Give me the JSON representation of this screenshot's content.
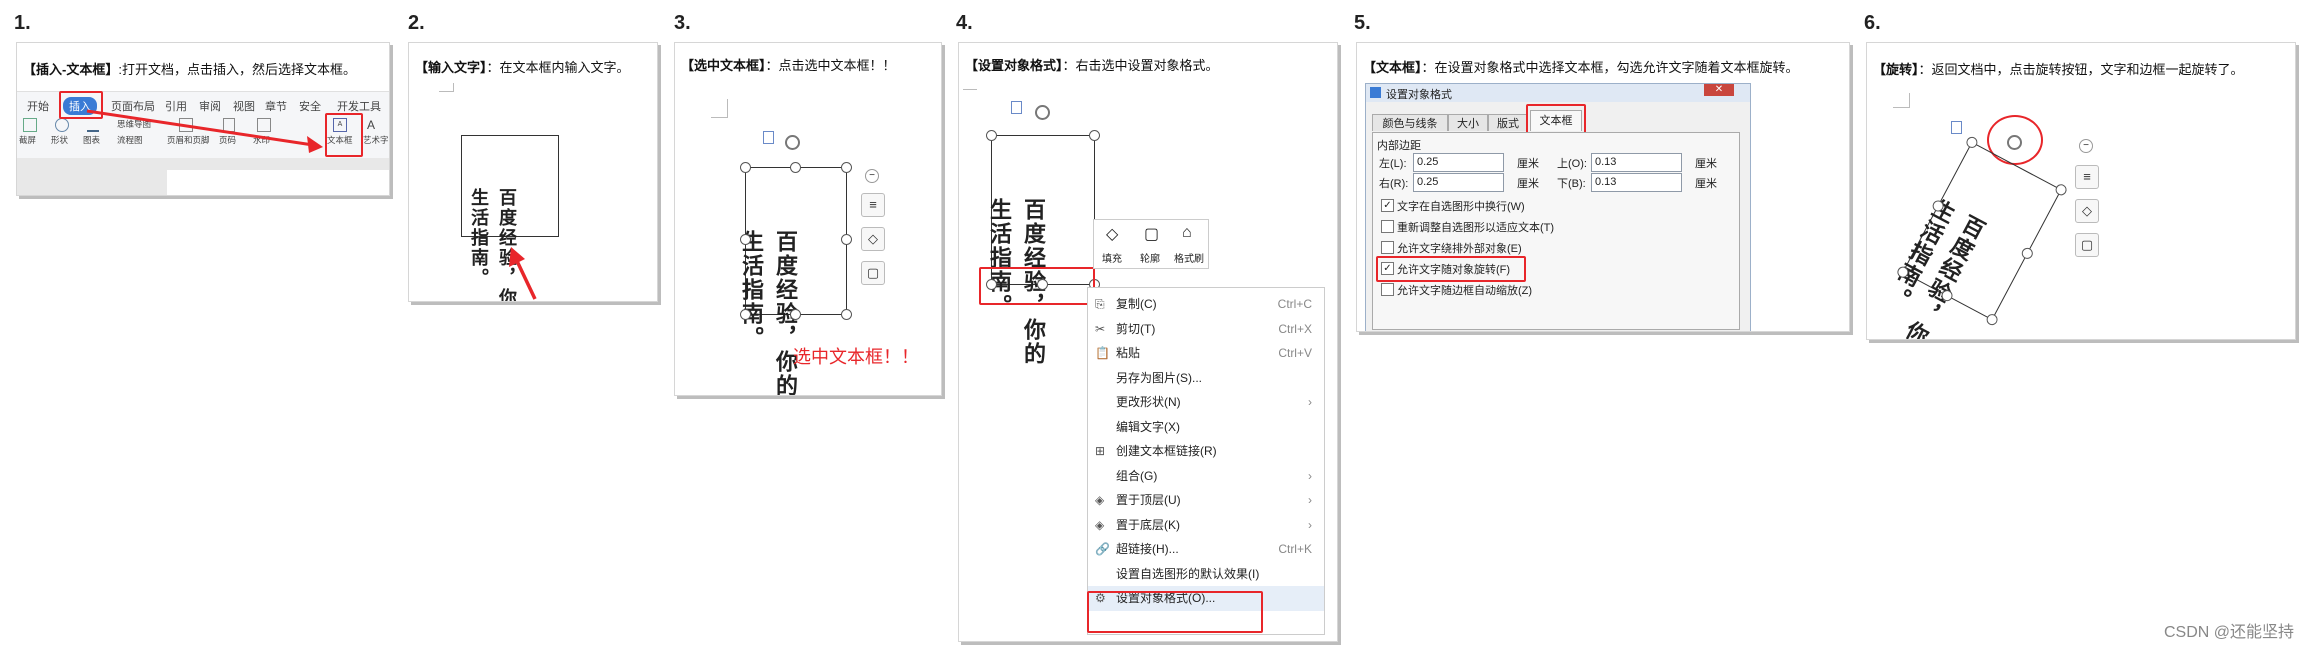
{
  "steps": [
    {
      "num": "1.",
      "caption_bold": "【插入-文本框】",
      "caption_rest": ":打开文档，点击插入，然后选择文本框。",
      "ribbon_tabs": [
        "开始",
        "插入",
        "页面布局",
        "引用",
        "审阅",
        "视图",
        "章节",
        "安全",
        "开发工具"
      ],
      "ribbon_items": [
        "截屏",
        "形状",
        "图表",
        "思维导图",
        "流程图",
        "页眉和页脚",
        "页码",
        "水印",
        "文本框",
        "艺术字"
      ]
    },
    {
      "num": "2.",
      "caption_bold": "【输入文字】",
      "caption_rest": "：在文本框内输入文字。"
    },
    {
      "num": "3.",
      "caption_bold": "【选中文本框】",
      "caption_rest": "：点击选中文本框！！",
      "red_note": "选中文本框！！"
    },
    {
      "num": "4.",
      "caption_bold": "【设置对象格式】",
      "caption_rest": "：右击选中设置对象格式。",
      "mini_toolbar": [
        "填充",
        "轮廓",
        "格式刷"
      ],
      "menu": [
        {
          "label": "复制(C)",
          "shortcut": "Ctrl+C",
          "icon": "⎘"
        },
        {
          "label": "剪切(T)",
          "shortcut": "Ctrl+X",
          "icon": "✂"
        },
        {
          "label": "粘贴",
          "shortcut": "Ctrl+V",
          "icon": "📋"
        },
        {
          "label": "另存为图片(S)...",
          "shortcut": "",
          "icon": ""
        },
        {
          "label": "更改形状(N)",
          "shortcut": "›",
          "icon": ""
        },
        {
          "label": "编辑文字(X)",
          "shortcut": "",
          "icon": ""
        },
        {
          "label": "创建文本框链接(R)",
          "shortcut": "",
          "icon": "⊞"
        },
        {
          "label": "组合(G)",
          "shortcut": "›",
          "icon": ""
        },
        {
          "label": "置于顶层(U)",
          "shortcut": "›",
          "icon": "◈"
        },
        {
          "label": "置于底层(K)",
          "shortcut": "›",
          "icon": "◈"
        },
        {
          "label": "超链接(H)...",
          "shortcut": "Ctrl+K",
          "icon": "🔗"
        },
        {
          "label": "设置自选图形的默认效果(I)",
          "shortcut": "",
          "icon": ""
        },
        {
          "label": "设置对象格式(O)...",
          "shortcut": "",
          "icon": "⚙"
        }
      ]
    },
    {
      "num": "5.",
      "caption_bold": "【文本框】",
      "caption_rest": "：在设置对象格式中选择文本框，勾选允许文字随着文本框旋转。",
      "dialog_title": "设置对象格式",
      "dialog_tabs": [
        "颜色与线条",
        "大小",
        "版式",
        "文本框"
      ],
      "section": "内部边距",
      "margins": [
        {
          "label": "左(L):",
          "value": "0.25",
          "unit": "厘米"
        },
        {
          "label": "上(O):",
          "value": "0.13",
          "unit": "厘米"
        },
        {
          "label": "右(R):",
          "value": "0.25",
          "unit": "厘米"
        },
        {
          "label": "下(B):",
          "value": "0.13",
          "unit": "厘米"
        }
      ],
      "options": [
        {
          "label": "文字在自选图形中换行(W)",
          "checked": true
        },
        {
          "label": "重新调整自选图形以适应文本(T)",
          "checked": false
        },
        {
          "label": "允许文字绕排外部对象(E)",
          "checked": false
        },
        {
          "label": "允许文字随对象旋转(F)",
          "checked": true
        },
        {
          "label": "允许文字随边框自动缩放(Z)",
          "checked": false
        }
      ]
    },
    {
      "num": "6.",
      "caption_bold": "【旋转】",
      "caption_rest": "：返回文档中，点击旋转按钮，文字和边框一起旋转了。"
    }
  ],
  "textbox_text": {
    "col1": "百度经验，你的",
    "col2": "生活指南。"
  },
  "watermark": "CSDN @还能坚持",
  "colors": {
    "accent_red": "#e8262a",
    "insert_tab_blue": "#3a7bd5"
  }
}
